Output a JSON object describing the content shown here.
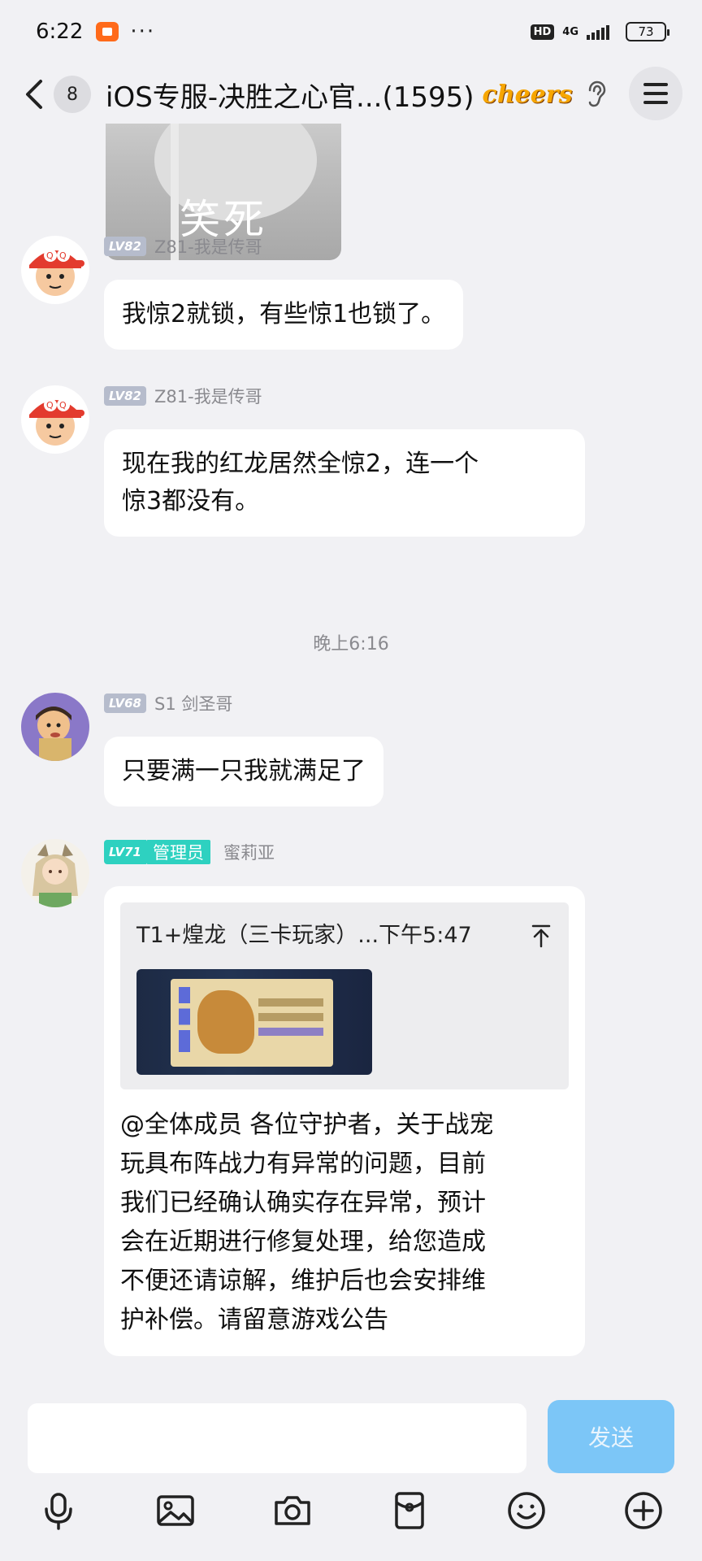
{
  "status_bar": {
    "time": "6:22",
    "more": "···",
    "hd": "HD",
    "network": "4G",
    "battery": "73"
  },
  "header": {
    "unread_count": "8",
    "title": "iOS专服-决胜之心官...(1595)",
    "badge_text": "cheers"
  },
  "messages": {
    "image_message": {
      "caption": "笑死"
    },
    "msg1": {
      "level": "LV82",
      "nickname": "Z81-我是传哥",
      "text": "我惊2就锁，有些惊1也锁了。"
    },
    "msg2": {
      "level": "LV82",
      "nickname": "Z81-我是传哥",
      "text_line1": "现在我的红龙居然全惊2，连一个",
      "text_line2": "惊3都没有。"
    },
    "time_divider": "晚上6:16",
    "msg3": {
      "level": "LV68",
      "nickname": "S1 剑圣哥",
      "text": "只要满一只我就满足了"
    },
    "msg4": {
      "level": "LV71",
      "role": "管理员",
      "nickname": "蜜莉亚",
      "quote_header": "T1+煌龙（三卡玩家）...下午5:47",
      "lines": [
        "@全体成员 各位守护者，关于战宠",
        "玩具布阵战力有异常的问题，目前",
        "我们已经确认确实存在异常，预计",
        "会在近期进行修复处理，给您造成",
        "不便还请谅解，维护后也会安排维",
        "护补偿。请留意游戏公告"
      ]
    }
  },
  "input": {
    "value": "",
    "send_label": "发送"
  },
  "toolbar": {
    "icons": [
      "microphone-icon",
      "image-icon",
      "camera-icon",
      "red-packet-icon",
      "emoji-icon",
      "plus-icon"
    ]
  },
  "colors": {
    "background": "#f1f1f4",
    "bubble": "#ffffff",
    "send_button": "#7cc6f7",
    "admin_badge": "#2ed1c0",
    "level_badge": "#b6bccc"
  }
}
